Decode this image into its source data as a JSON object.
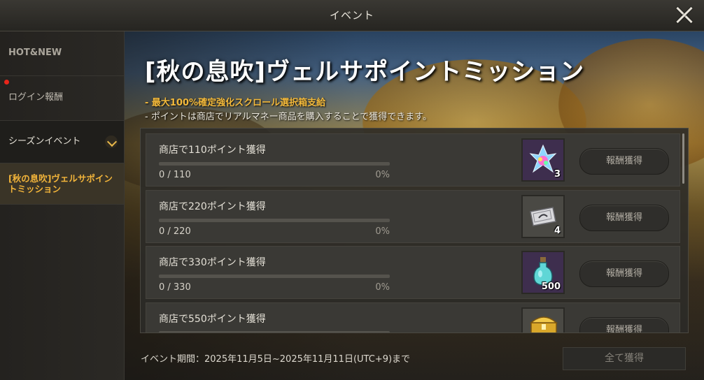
{
  "window": {
    "title": "イベント"
  },
  "sidebar": {
    "items": [
      {
        "label": "HOT&NEW"
      },
      {
        "label": "ログイン報酬"
      },
      {
        "label": "シーズンイベント"
      },
      {
        "label": "[秋の息吹]ヴェルサポイントミッション"
      }
    ]
  },
  "event": {
    "title": "[秋の息吹]ヴェルサポイントミッション",
    "note1": "- 最大100%確定強化スクロール選択箱支給",
    "note2": "- ポイントは商店でリアルマネー商品を購入することで獲得できます。"
  },
  "missions": [
    {
      "label": "商店で110ポイント獲得",
      "count": "0 / 110",
      "percent": "0%",
      "progress": 0,
      "reward_icon": "crystal-icon",
      "reward_qty": "3",
      "button": "報酬獲得"
    },
    {
      "label": "商店で220ポイント獲得",
      "count": "0 / 220",
      "percent": "0%",
      "progress": 0,
      "reward_icon": "ticket-icon",
      "reward_qty": "4",
      "button": "報酬獲得"
    },
    {
      "label": "商店で330ポイント獲得",
      "count": "0 / 330",
      "percent": "0%",
      "progress": 0,
      "reward_icon": "potion-icon",
      "reward_qty": "500",
      "button": "報酬獲得"
    },
    {
      "label": "商店で550ポイント獲得",
      "count": "",
      "percent": "",
      "progress": 0,
      "reward_icon": "chest-icon",
      "reward_qty": "",
      "button": "報酬獲得"
    }
  ],
  "footer": {
    "period": "イベント期間：2025年11月5日~2025年11月11日(UTC+9)まで",
    "claim_all": "全て獲得"
  },
  "colors": {
    "accent": "#f2b43a",
    "notification": "#e8251a"
  }
}
